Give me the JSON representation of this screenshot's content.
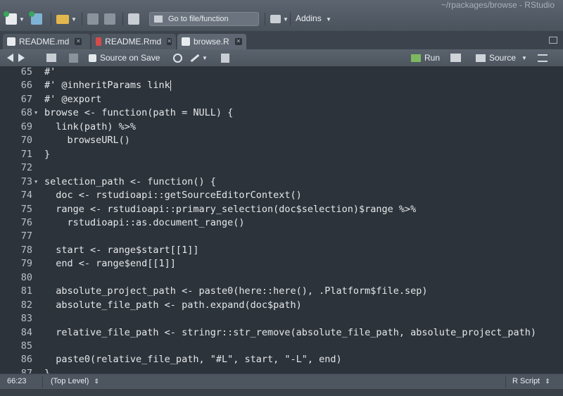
{
  "window": {
    "title": "~/rpackages/browse - RStudio"
  },
  "toolbar": {
    "goto_placeholder": "Go to file/function",
    "addins_label": "Addins",
    "icons": [
      "new-file-icon",
      "new-project-icon",
      "open-folder-icon",
      "save-icon",
      "print-icon",
      "grid-layout-icon"
    ]
  },
  "tabs": [
    {
      "label": "README.md",
      "icon": "md-file-icon",
      "active": false
    },
    {
      "label": "README.Rmd",
      "icon": "rmd-file-icon",
      "active": false
    },
    {
      "label": "browse.R",
      "icon": "r-file-icon",
      "active": true
    }
  ],
  "editor_toolbar": {
    "source_on_save": "Source on Save",
    "run": "Run",
    "source": "Source"
  },
  "code": {
    "lines": [
      {
        "n": "65",
        "fold": false,
        "text": "#'"
      },
      {
        "n": "66",
        "fold": false,
        "text": "#' @inheritParams link"
      },
      {
        "n": "67",
        "fold": false,
        "text": "#' @export"
      },
      {
        "n": "68",
        "fold": true,
        "text": "browse <- function(path = NULL) {"
      },
      {
        "n": "69",
        "fold": false,
        "text": "  link(path) %>%"
      },
      {
        "n": "70",
        "fold": false,
        "text": "    browseURL()"
      },
      {
        "n": "71",
        "fold": false,
        "text": "}"
      },
      {
        "n": "72",
        "fold": false,
        "text": ""
      },
      {
        "n": "73",
        "fold": true,
        "text": "selection_path <- function() {"
      },
      {
        "n": "74",
        "fold": false,
        "text": "  doc <- rstudioapi::getSourceEditorContext()"
      },
      {
        "n": "75",
        "fold": false,
        "text": "  range <- rstudioapi::primary_selection(doc$selection)$range %>%"
      },
      {
        "n": "76",
        "fold": false,
        "text": "    rstudioapi::as.document_range()"
      },
      {
        "n": "77",
        "fold": false,
        "text": ""
      },
      {
        "n": "78",
        "fold": false,
        "text": "  start <- range$start[[1]]"
      },
      {
        "n": "79",
        "fold": false,
        "text": "  end <- range$end[[1]]"
      },
      {
        "n": "80",
        "fold": false,
        "text": ""
      },
      {
        "n": "81",
        "fold": false,
        "text": "  absolute_project_path <- paste0(here::here(), .Platform$file.sep)"
      },
      {
        "n": "82",
        "fold": false,
        "text": "  absolute_file_path <- path.expand(doc$path)"
      },
      {
        "n": "83",
        "fold": false,
        "text": ""
      },
      {
        "n": "84",
        "fold": false,
        "text": "  relative_file_path <- stringr::str_remove(absolute_file_path, absolute_project_path)"
      },
      {
        "n": "85",
        "fold": false,
        "text": ""
      },
      {
        "n": "86",
        "fold": false,
        "text": "  paste0(relative_file_path, \"#L\", start, \"-L\", end)"
      },
      {
        "n": "87",
        "fold": false,
        "text": "}"
      }
    ]
  },
  "status": {
    "position": "66:23",
    "scope": "(Top Level)",
    "file_type": "R Script"
  },
  "colors": {
    "background": "#2c333b",
    "code_text": "#e6e8ea",
    "line_number": "#b9c0c7",
    "toolbar": "#5a636d"
  }
}
